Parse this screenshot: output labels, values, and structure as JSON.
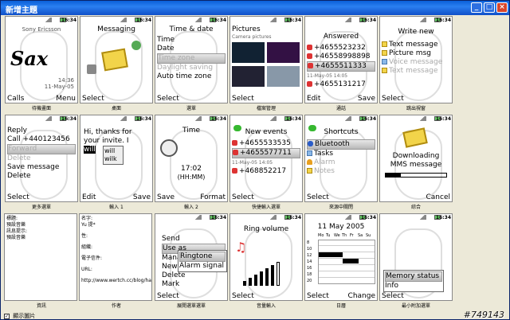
{
  "window": {
    "title": "新增主題",
    "minimize": "_",
    "maximize": "□",
    "close": "×"
  },
  "status_time": "16:34",
  "rows": [
    [
      {
        "id": "wallpaper",
        "caption": "待機畫面",
        "header": "Sony Ericsson",
        "lines": [
          "Sax",
          "14:36",
          "11-May-05"
        ],
        "left": "Calls",
        "right": "Menu"
      },
      {
        "id": "desktop",
        "caption": "桌面",
        "header": "Messaging",
        "lines": [],
        "left": "Select",
        "right": ""
      },
      {
        "id": "settings",
        "caption": "選單",
        "header": "Time & date",
        "lines": [
          "Time",
          "Date",
          "Time zone",
          "Daylight saving",
          "Auto time zone"
        ],
        "left": "Select",
        "right": ""
      },
      {
        "id": "fileman",
        "caption": "檔案管理",
        "header": "Pictures",
        "lines": [
          "Camera pictures"
        ],
        "left": "Select",
        "right": ""
      },
      {
        "id": "calls",
        "caption": "通話",
        "header": "Answered",
        "lines": [
          "+4655523232",
          "+46558998898",
          "+4655511333",
          "11-May-05   14:05",
          "+4655131217"
        ],
        "left": "Edit",
        "right": "Save"
      },
      {
        "id": "popup",
        "caption": "跳出視窗",
        "header": "Write new",
        "lines": [
          "Text message",
          "Picture msg",
          "Voice message",
          "Text message"
        ],
        "left": "Select",
        "right": ""
      }
    ],
    [
      {
        "id": "more",
        "caption": "更多選單",
        "header": "",
        "lines": [
          "Reply",
          "Call +440123456",
          "Forward",
          "Delete",
          "Save message",
          "Delete"
        ],
        "left": "Select",
        "right": ""
      },
      {
        "id": "input1",
        "caption": "輸入 1",
        "header": "Hi, thanks for",
        "lines": [
          "your invite. I",
          "will",
          "will",
          "wilk"
        ],
        "left": "Edit",
        "right": "Save"
      },
      {
        "id": "input2",
        "caption": "輸入 2",
        "header": "Time",
        "lines": [
          "17:02",
          "(HH:MM)"
        ],
        "left": "Save",
        "right": "Format"
      },
      {
        "id": "shortcut_entry",
        "caption": "快捷輸入選單",
        "header": "New events",
        "lines": [
          "+4655533535",
          "+4655577711",
          "11-May-05   14:05",
          "+468852217"
        ],
        "left": "Select",
        "right": ""
      },
      {
        "id": "incoming",
        "caption": "來源中關閉",
        "header": "Shortcuts",
        "lines": [
          "Bluetooth",
          "Tasks",
          "Alarm",
          "Notes"
        ],
        "left": "Select",
        "right": ""
      },
      {
        "id": "combined",
        "caption": "綜合",
        "header": "Downloading",
        "lines": [
          "MMS message"
        ],
        "left": "",
        "right": "Cancel"
      }
    ],
    [
      {
        "id": "info",
        "caption": "資訊",
        "panel": [
          "標題:",
          "    預設音樂",
          "訊息提示:",
          "    預設音樂"
        ]
      },
      {
        "id": "author",
        "caption": "作者",
        "panel": [
          "名字:",
          "    Yu 提*",
          "性:",
          "組織:",
          "電子信件:",
          "URL:",
          "http://www.wertch.cc/blog/har"
        ]
      },
      {
        "id": "expand",
        "caption": "展開選單選單",
        "header": "",
        "lines": [
          "Send",
          "Use as",
          "Manage",
          "New",
          "Delete",
          "Mark"
        ],
        "popup": [
          "Ringtone",
          "Alarm signal"
        ],
        "left": "Select",
        "right": ""
      },
      {
        "id": "volume",
        "caption": "音量輸入",
        "header": "Ring volume",
        "lines": [],
        "left": "Select",
        "right": ""
      },
      {
        "id": "calendar",
        "caption": "日曆",
        "header": "11 May 2005",
        "days": [
          "Mo",
          "Tu",
          "We",
          "Th",
          "Fr",
          "Sa",
          "Su"
        ],
        "hours": [
          "8",
          "10",
          "12",
          "14",
          "16",
          "18",
          "20"
        ],
        "left": "Select",
        "right": "Change"
      },
      {
        "id": "mini",
        "caption": "最小附加選單",
        "header": "",
        "lines": [
          "Memory status",
          "Info"
        ],
        "left": "Select",
        "right": ""
      }
    ]
  ],
  "statusbar": {
    "checkbox": "✓",
    "label": "顯示圖片"
  },
  "watermark": "#749143",
  "colors": {
    "titlebar": "#0a5fd8",
    "env": "#f2d44a",
    "accent_green": "#36b830"
  }
}
